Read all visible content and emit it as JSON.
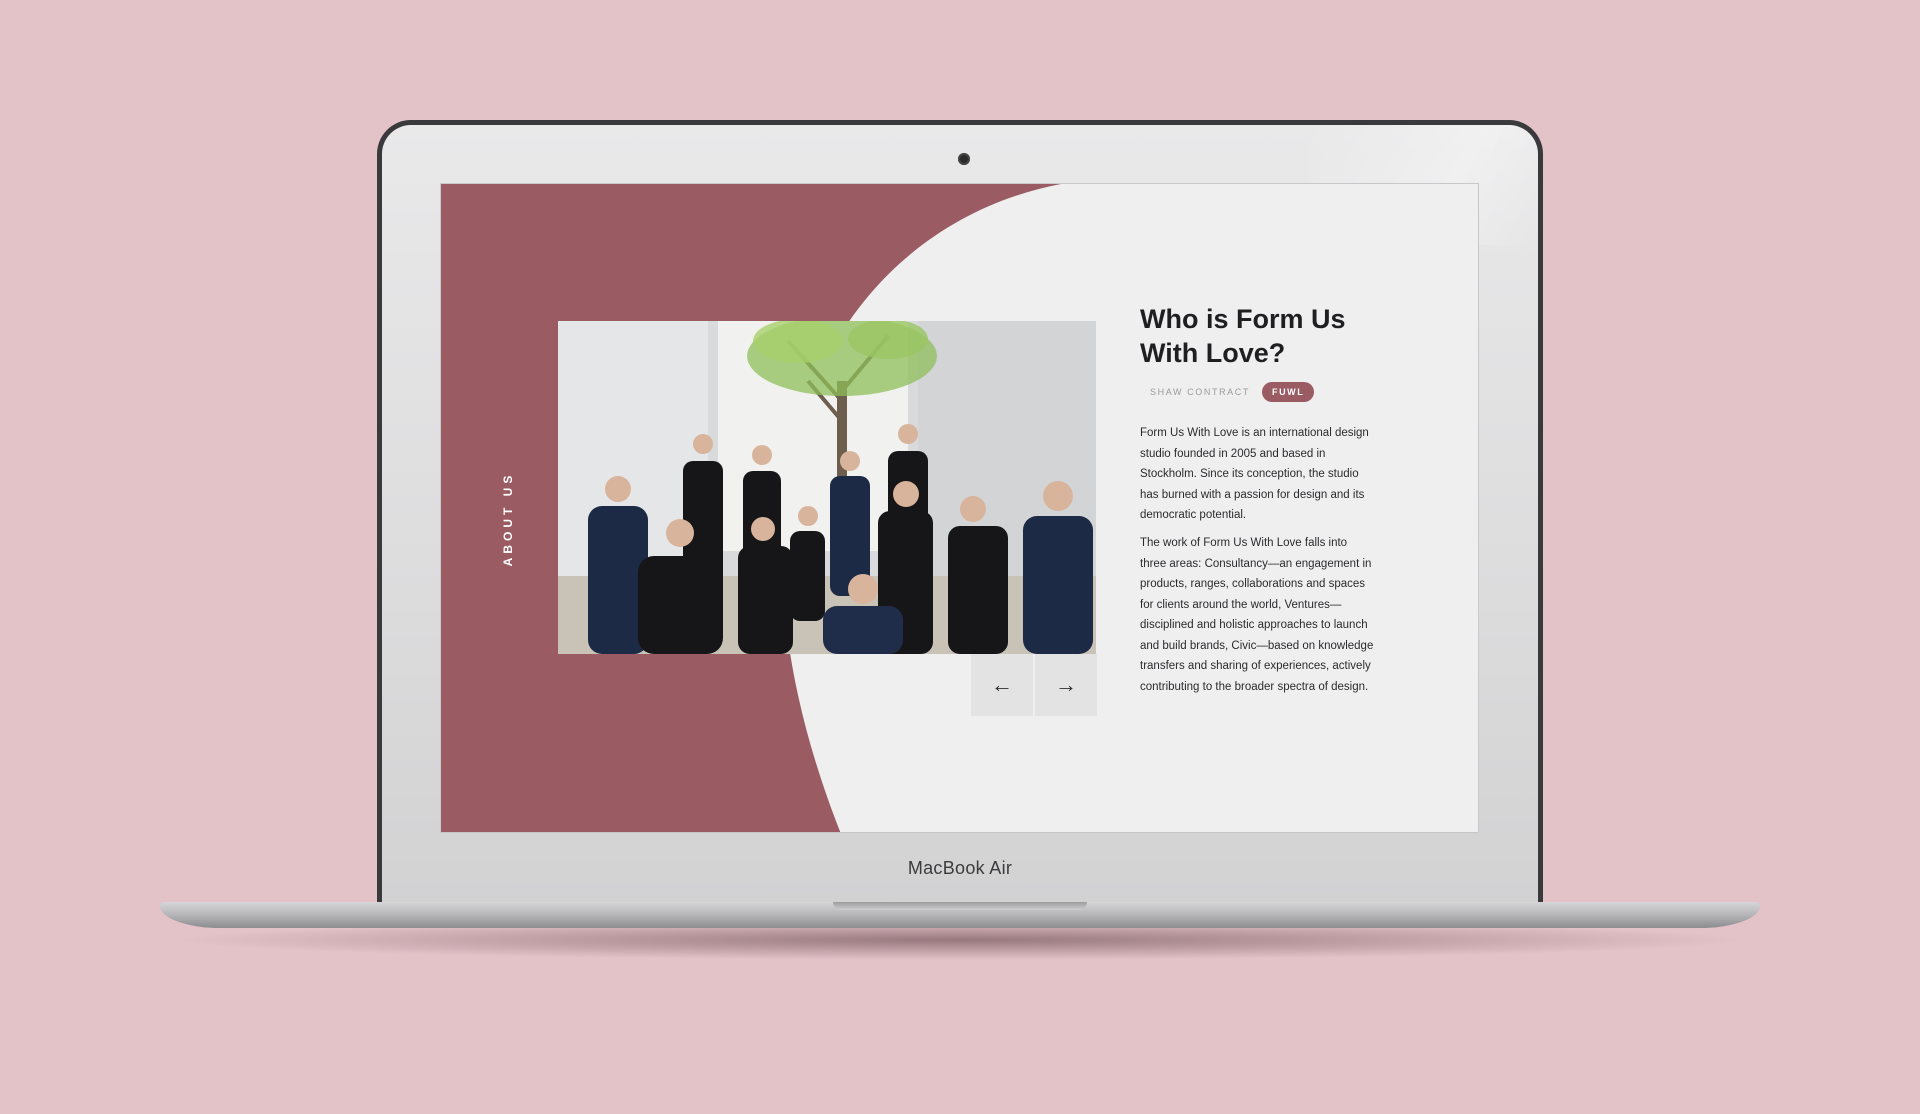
{
  "device": {
    "brand_label": "MacBook Air"
  },
  "colors": {
    "page_background": "#e3c3c8",
    "accent": "#9a5b62",
    "screen_background": "#efeff0"
  },
  "page": {
    "section_label": "ABOUT US",
    "heading": "Who is Form Us With Love?",
    "tabs": [
      {
        "label": "SHAW CONTRACT",
        "active": false
      },
      {
        "label": "FUWL",
        "active": true
      }
    ],
    "paragraphs": [
      "Form Us With Love is an international design studio founded in 2005 and based in Stockholm. Since its conception, the studio has burned with a passion for design and its democratic potential.",
      "The work of Form Us With Love falls into three areas: Consultancy—an engagement in products, ranges, collaborations and spaces for clients around the world, Ventures—disciplined and holistic approaches to launch and build brands, Civic—based on knowledge transfers and sharing of experiences, actively contributing to the broader spectra of design."
    ],
    "carousel": {
      "prev_icon": "arrow-left-icon",
      "next_icon": "arrow-right-icon",
      "prev_glyph": "←",
      "next_glyph": "→"
    }
  }
}
